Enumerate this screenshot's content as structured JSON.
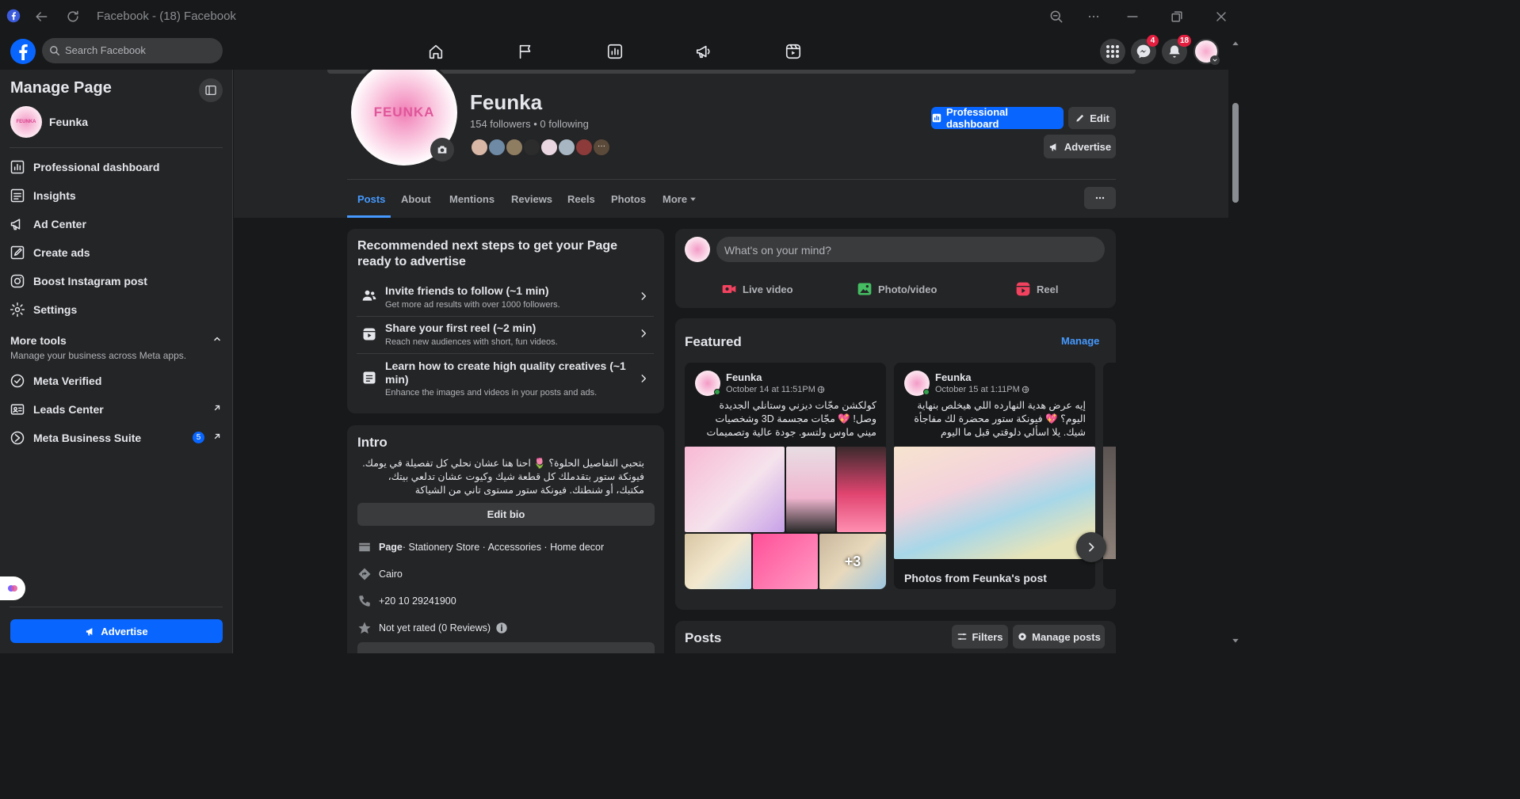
{
  "window": {
    "title": "Facebook - (18) Facebook"
  },
  "header": {
    "search_placeholder": "Search Facebook",
    "messenger_badge": "4",
    "notifications_badge": "18"
  },
  "sidebar": {
    "title": "Manage Page",
    "page_name": "Feunka",
    "items": [
      {
        "label": "Professional dashboard"
      },
      {
        "label": "Insights"
      },
      {
        "label": "Ad Center"
      },
      {
        "label": "Create ads"
      },
      {
        "label": "Boost Instagram post"
      },
      {
        "label": "Settings"
      }
    ],
    "more_tools": {
      "title": "More tools",
      "subtitle": "Manage your business across Meta apps."
    },
    "tools": [
      {
        "label": "Meta Verified"
      },
      {
        "label": "Leads Center"
      },
      {
        "label": "Meta Business Suite",
        "badge": "5"
      }
    ],
    "advertise_label": "Advertise"
  },
  "profile": {
    "logo_text": "FEUNKA",
    "name": "Feunka",
    "stats": "154 followers • 0 following",
    "professional_dashboard_label": "Professional dashboard",
    "edit_label": "Edit",
    "advertise_label": "Advertise",
    "more_dots": "···"
  },
  "tabs": [
    {
      "label": "Posts"
    },
    {
      "label": "About"
    },
    {
      "label": "Mentions"
    },
    {
      "label": "Reviews"
    },
    {
      "label": "Reels"
    },
    {
      "label": "Photos"
    },
    {
      "label": "More"
    }
  ],
  "steps_card": {
    "title": "Recommended next steps to get your Page ready to advertise",
    "steps": [
      {
        "title": "Invite friends to follow (~1 min)",
        "desc": "Get more ad results with over 1000 followers."
      },
      {
        "title": "Share your first reel (~2 min)",
        "desc": "Reach new audiences with short, fun videos."
      },
      {
        "title": "Learn how to create high quality creatives (~1 min)",
        "desc": "Enhance the images and videos in your posts and ads."
      }
    ]
  },
  "intro": {
    "title": "Intro",
    "bio": "بتحبي التفاصيل الحلوة؟ 🌷 احنا هنا عشان نحلي كل تفصيلة في يومك. فيونكة ستور بتقدملك كل قطعة شيك وكيوت عشان تدلعي بيتك، مكتبك، أو شنطتك. فيونكة ستور مستوى تاني من الشياكة",
    "edit_bio_label": "Edit bio",
    "page_type_prefix": "Page",
    "page_type_rest": " · Stationery Store · Accessories · Home decor",
    "location": "Cairo",
    "phone": "+20 10 29241900",
    "rating": "Not yet rated (0 Reviews)"
  },
  "composer": {
    "placeholder": "What's on your mind?",
    "live_label": "Live video",
    "photo_label": "Photo/video",
    "reel_label": "Reel"
  },
  "featured": {
    "title": "Featured",
    "manage_label": "Manage",
    "posts": [
      {
        "author": "Feunka",
        "date": "October 14 at 11:51PM",
        "text": "كولكشن مجّات ديزني وستانلي الجديدة وصل! 💖 مجّات مجسمة 3D وشخصيات ميني ماوس ولتسو. جودة عالية وتصميمات تخط...",
        "more_count": "+3"
      },
      {
        "author": "Feunka",
        "date": "October 15 at 1:11PM",
        "text": "إيه عرض هدية النهارده اللي هيخلص بنهاية اليوم؟ 💖 فيونكة ستور محضرة لك مفاجأة شيك. يلا اسألي دلوقتي قبل ما اليوم يخلص!...",
        "caption": "Photos from Feunka's post"
      }
    ]
  },
  "posts_section": {
    "title": "Posts",
    "filters_label": "Filters",
    "manage_posts_label": "Manage posts"
  },
  "colors": {
    "accent": "#0866ff",
    "link": "#4599ff",
    "badge": "#e41e3f",
    "brand_pink": "#e0569a"
  }
}
